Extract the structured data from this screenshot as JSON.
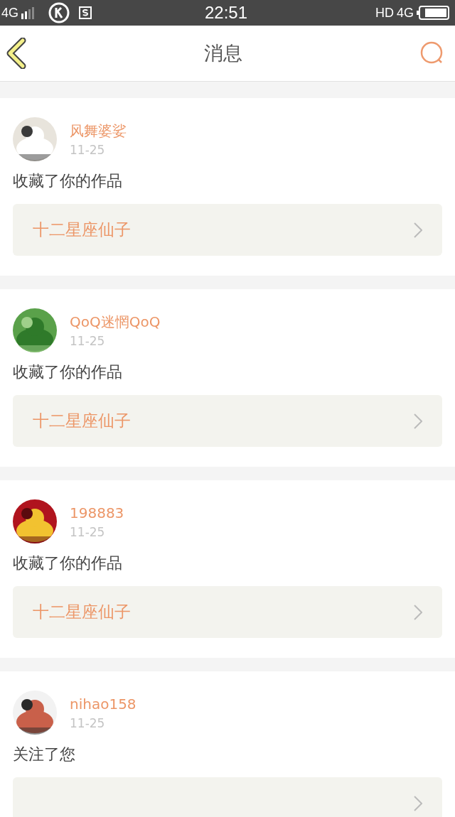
{
  "status_bar": {
    "network": "4G",
    "time": "22:51",
    "hd": "HD",
    "data_network": "4G"
  },
  "header": {
    "title": "消息"
  },
  "messages": [
    {
      "user": "风舞婆娑",
      "date": "11-25",
      "action": "收藏了你的作品",
      "work": "十二星座仙子"
    },
    {
      "user": "QoQ迷惘QoQ",
      "date": "11-25",
      "action": "收藏了你的作品",
      "work": "十二星座仙子"
    },
    {
      "user": "198883",
      "date": "11-25",
      "action": "收藏了你的作品",
      "work": "十二星座仙子"
    },
    {
      "user": "nihao158",
      "date": "11-25",
      "action": "关注了您"
    }
  ]
}
